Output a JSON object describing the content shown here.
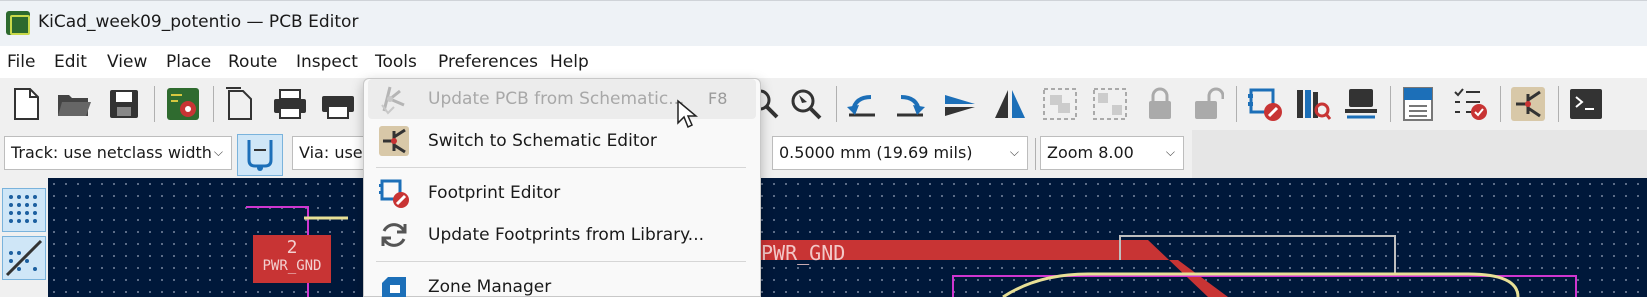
{
  "window": {
    "title": "KiCad_week09_potentio — PCB Editor"
  },
  "menubar": [
    "File",
    "Edit",
    "View",
    "Place",
    "Route",
    "Inspect",
    "Tools",
    "Preferences",
    "Help"
  ],
  "toolbar2": {
    "track_width": "Track: use netclass width",
    "via_size": "Via: use",
    "grid": "0.5000 mm (19.69 mils)",
    "zoom": "Zoom 8.00"
  },
  "canvas": {
    "pad_number": "2",
    "pad_net": "PWR_GND",
    "net_label": "PWR_GND",
    "colors": {
      "background": "#00183a",
      "copper": "#c83434",
      "outline": "#d036d0"
    }
  },
  "tools_menu": {
    "items": [
      {
        "label": "Update PCB from Schematic...",
        "shortcut": "F8",
        "enabled": false,
        "icon": "update-pcb-icon"
      },
      {
        "label": "Switch to Schematic Editor",
        "shortcut": "",
        "enabled": true,
        "icon": "schematic-editor-icon"
      },
      {
        "label": "Footprint Editor",
        "shortcut": "",
        "enabled": true,
        "icon": "footprint-editor-icon"
      },
      {
        "label": "Update Footprints from Library...",
        "shortcut": "",
        "enabled": true,
        "icon": "refresh-icon"
      },
      {
        "label": "Zone Manager",
        "shortcut": "",
        "enabled": true,
        "icon": "zone-manager-icon"
      }
    ]
  }
}
